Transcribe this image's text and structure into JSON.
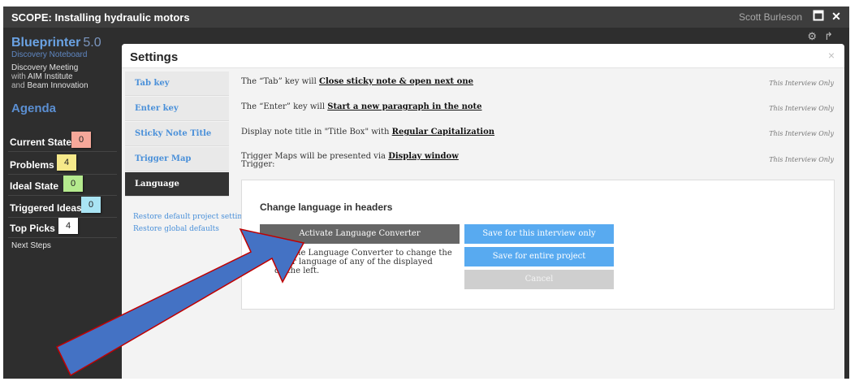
{
  "window": {
    "title": "SCOPE: Installing hydraulic motors",
    "user": "Scott Burleson",
    "maximize_icon": "maximize-icon",
    "close_icon": "close-icon"
  },
  "sidebar": {
    "brand": "Blueprinter",
    "version": "5.0",
    "subtitle": "Discovery Noteboard",
    "meeting_title": "Discovery Meeting",
    "meeting_line2_prefix": "with",
    "meeting_line2_name": "AIM Institute",
    "meeting_line3_prefix": "and",
    "meeting_line3_name": "Beam Innovation",
    "agenda_heading": "Agenda",
    "items": [
      {
        "label": "Current State",
        "count": "0",
        "color": "#f6a89a"
      },
      {
        "label": "Problems",
        "count": "4",
        "color": "#f6e98a"
      },
      {
        "label": "Ideal State",
        "count": "0",
        "color": "#b5ea8e"
      },
      {
        "label": "Triggered Ideas",
        "count": "0",
        "color": "#a9e4f4"
      },
      {
        "label": "Top Picks",
        "count": "4",
        "color": "#ffffff"
      }
    ],
    "next_steps": "Next Steps"
  },
  "dialog": {
    "title": "Settings",
    "close_glyph": "×",
    "tabs": [
      "Tab key",
      "Enter key",
      "Sticky Note Title Box",
      "Trigger Map",
      "Language"
    ],
    "active_tab": "Language",
    "links": [
      "Restore default project settings",
      "Restore global defaults"
    ],
    "rows": [
      {
        "prefix": "The “Tab” key will",
        "value": "Close sticky note & open next one",
        "scope": "This Interview Only"
      },
      {
        "prefix": "The “Enter” key will",
        "value": "Start a new paragraph in the note",
        "scope": "This Interview Only"
      },
      {
        "prefix": "Display note title in \"Title Box\" with",
        "value": "Regular Capitalization",
        "scope": "This Interview Only"
      },
      {
        "prefix": "Trigger Maps will be presented via",
        "value": "Display window",
        "line2": "Trigger:",
        "scope": "This Interview Only"
      }
    ],
    "language_panel": {
      "heading": "Change language in headers",
      "activate_button": "Activate Language Converter",
      "description_1": "the Language Converter to change the",
      "description_2": "or language of any of the displayed",
      "description_3": "on the left.",
      "save_interview": "Save for this interview only",
      "save_project": "Save for entire project",
      "cancel": "Cancel"
    }
  },
  "annotation": {
    "arrow_fill": "#4472c4",
    "arrow_stroke": "#c00000"
  },
  "colors": {
    "accent_blue": "#58aaf0",
    "link_blue": "#4a90d9",
    "dark_bg": "#2e2e2e"
  }
}
